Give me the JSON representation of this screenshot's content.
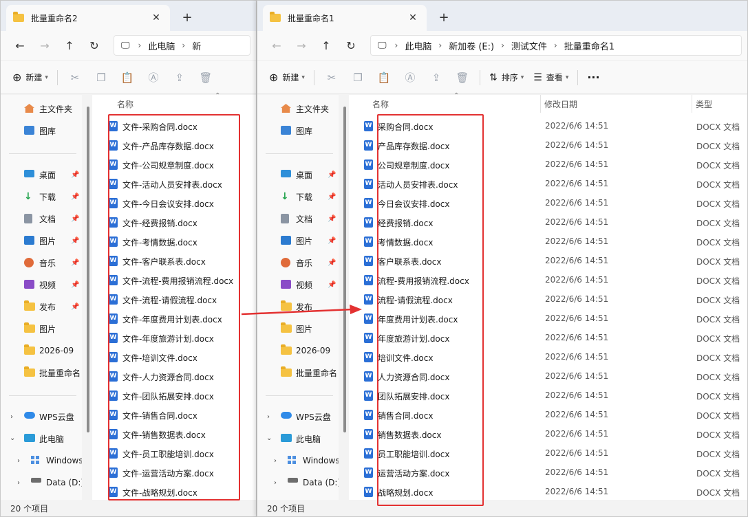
{
  "left_window": {
    "tab_title": "批量重命名2",
    "breadcrumb": [
      "此电脑",
      "新"
    ],
    "toolbar": {
      "new_label": "新建"
    },
    "col_name": "名称",
    "status": "20 个项目",
    "files": [
      "文件-采购合同.docx",
      "文件-产品库存数据.docx",
      "文件-公司规章制度.docx",
      "文件-活动人员安排表.docx",
      "文件-今日会议安排.docx",
      "文件-经费报销.docx",
      "文件-考情数据.docx",
      "文件-客户联系表.docx",
      "文件-流程-费用报销流程.docx",
      "文件-流程-请假流程.docx",
      "文件-年度费用计划表.docx",
      "文件-年度旅游计划.docx",
      "文件-培训文件.docx",
      "文件-人力资源合同.docx",
      "文件-团队拓展安排.docx",
      "文件-销售合同.docx",
      "文件-销售数据表.docx",
      "文件-员工职能培训.docx",
      "文件-运营活动方案.docx",
      "文件-战略规划.docx"
    ]
  },
  "right_window": {
    "tab_title": "批量重命名1",
    "breadcrumb": [
      "此电脑",
      "新加卷 (E:)",
      "测试文件",
      "批量重命名1"
    ],
    "toolbar": {
      "new_label": "新建",
      "sort_label": "排序",
      "view_label": "查看",
      "more_label": "···"
    },
    "col_name": "名称",
    "col_date": "修改日期",
    "col_type": "类型",
    "status": "20 个项目",
    "file_date": "2022/6/6 14:51",
    "file_type": "DOCX 文档",
    "files": [
      "采购合同.docx",
      "产品库存数据.docx",
      "公司规章制度.docx",
      "活动人员安排表.docx",
      "今日会议安排.docx",
      "经费报销.docx",
      "考情数据.docx",
      "客户联系表.docx",
      "流程-费用报销流程.docx",
      "流程-请假流程.docx",
      "年度费用计划表.docx",
      "年度旅游计划.docx",
      "培训文件.docx",
      "人力资源合同.docx",
      "团队拓展安排.docx",
      "销售合同.docx",
      "销售数据表.docx",
      "员工职能培训.docx",
      "运营活动方案.docx",
      "战略规划.docx"
    ]
  },
  "sidebar": {
    "home": "主文件夹",
    "gallery": "图库",
    "desktop": "桌面",
    "downloads": "下载",
    "documents": "文档",
    "pictures": "图片",
    "music": "音乐",
    "videos": "视频",
    "publish": "发布",
    "pictures2": "图片",
    "folder_2026": "2026-09",
    "batch_folder": "批量重命名",
    "wps_cloud": "WPS云盘",
    "this_pc": "此电脑",
    "windows_drive": "Windows",
    "data_drive": "Data (D:)"
  },
  "icons": {
    "home": "home-icon",
    "gallery": "gallery-icon",
    "desktop": "desktop-icon",
    "downloads": "download-icon",
    "documents": "document-icon",
    "pictures": "picture-icon",
    "music": "music-icon",
    "videos": "video-icon",
    "folder": "folder-icon",
    "cloud": "cloud-icon",
    "pc": "computer-icon",
    "windows": "windows-icon",
    "drive": "drive-icon",
    "word": "word-doc-icon"
  },
  "colors": {
    "highlight_box": "#e33131",
    "word_blue": "#2b6fd6",
    "folder_yellow": "#f5c242"
  }
}
